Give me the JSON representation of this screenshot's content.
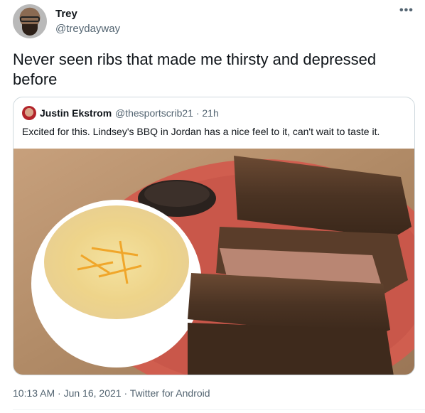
{
  "tweet": {
    "author": {
      "name": "Trey",
      "handle": "@treydayway"
    },
    "text": "Never seen ribs that made me thirsty and depressed before",
    "more_icon": "more-horizontal-icon",
    "meta": "10:13 AM · Jun 16, 2021 · Twitter for Android"
  },
  "quote": {
    "author": {
      "name": "Justin Ekstrom",
      "handle": "@thesportscrib21 · 21h"
    },
    "text": "Excited for this. Lindsey's BBQ in Jordan has a nice feel to it, can't wait to taste it."
  },
  "colors": {
    "text": "#0f1419",
    "secondary": "#536471",
    "border": "#cfd9de"
  }
}
